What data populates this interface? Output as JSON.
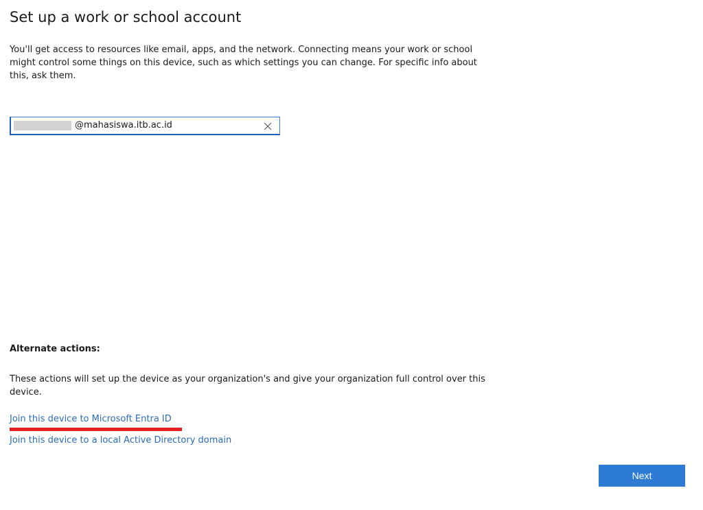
{
  "page": {
    "title": "Set up a work or school account",
    "intro": "You'll get access to resources like email, apps, and the network. Connecting means your work or school might control some things on this device, such as which settings you can change. For specific info about this, ask them."
  },
  "email_field": {
    "value_domain": "@mahasiswa.itb.ac.id",
    "clear_icon": "close-icon"
  },
  "alternate": {
    "heading": "Alternate actions:",
    "description": "These actions will set up the device as your organization's and give your organization full control over this device.",
    "links": [
      {
        "label": "Join this device to Microsoft Entra ID"
      },
      {
        "label": "Join this device to a local Active Directory domain"
      }
    ]
  },
  "footer": {
    "next_label": "Next"
  },
  "colors": {
    "accent": "#2d7bd4",
    "link": "#2b6cb8",
    "highlight": "#e5201f"
  }
}
